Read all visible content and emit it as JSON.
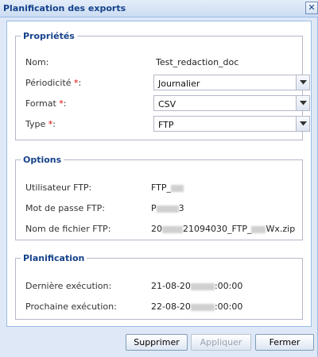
{
  "dialog": {
    "title": "Planification des exports",
    "close_glyph": "✕"
  },
  "props": {
    "legend": "Propriétés",
    "name_label": "Nom:",
    "name_value": "Test_redaction_doc",
    "periodicity_label": "Périodicité",
    "periodicity_value": "Journalier",
    "format_label": "Format",
    "format_value": "CSV",
    "type_label": "Type",
    "type_value": "FTP",
    "required_mark": "*",
    "colon": ":"
  },
  "options": {
    "legend": "Options",
    "user_label": "Utilisateur FTP:",
    "user_value_prefix": "FTP_",
    "password_label": "Mot de passe FTP:",
    "password_prefix": "P",
    "password_suffix": "3",
    "filename_label": "Nom de fichier FTP:",
    "filename_prefix": "20",
    "filename_middle": "21094030_FTP_",
    "filename_suffix": "Wx.zip"
  },
  "schedule": {
    "legend": "Planification",
    "last_label": "Dernière exécution:",
    "last_prefix": "21-08-20",
    "last_suffix": ":00:00",
    "next_label": "Prochaine exécution:",
    "next_prefix": "22-08-20",
    "next_suffix": ":00:00"
  },
  "buttons": {
    "delete": "Supprimer",
    "apply": "Appliquer",
    "close": "Fermer"
  },
  "colors": {
    "accent": "#15428b",
    "required": "#dd0000",
    "border": "#99bbe8"
  },
  "icons": {
    "close": "close-icon",
    "dropdown": "chevron-down-icon"
  }
}
